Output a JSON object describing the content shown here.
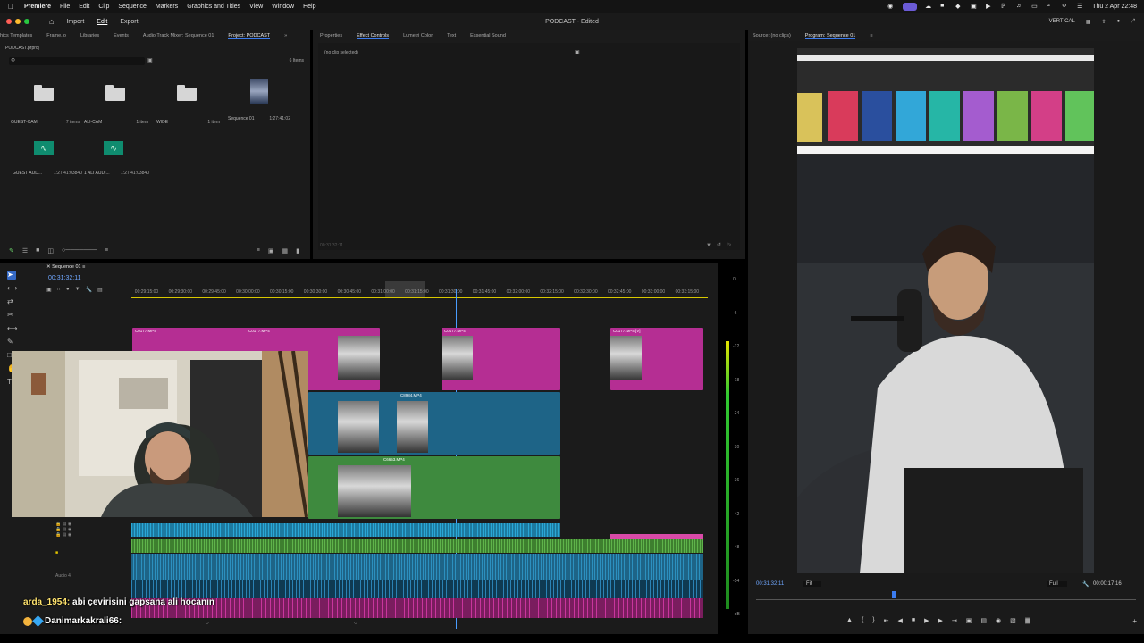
{
  "menubar": {
    "app": "Premiere",
    "items": [
      "File",
      "Edit",
      "Clip",
      "Sequence",
      "Markers",
      "Graphics and Titles",
      "View",
      "Window",
      "Help"
    ],
    "vertical_label": "VERTICAL",
    "datetime": "Thu 2 Apr  22:48"
  },
  "header": {
    "tabs": [
      "Import",
      "Edit",
      "Export"
    ],
    "active_tab": "Edit",
    "doc_title": "PODCAST - Edited"
  },
  "project": {
    "tabs": [
      "hics Templates",
      "Frame.io",
      "Libraries",
      "Events",
      "Audio Track Mixer: Sequence 01",
      "Project: PODCAST"
    ],
    "active_tab": "Project: PODCAST",
    "filename": "PODCAST.prproj",
    "item_count": "6 Items",
    "assets": [
      {
        "name": "GUEST-CAM",
        "count": "7 items",
        "kind": "folder"
      },
      {
        "name": "ALI-CAM",
        "count": "1 item",
        "kind": "folder"
      },
      {
        "name": "WIDE",
        "count": "1 item",
        "kind": "folder"
      },
      {
        "name": "Sequence 01",
        "count": "1:27:41:02",
        "kind": "sequence"
      },
      {
        "name": "GUEST AUD...",
        "count": "1:27:41:03840",
        "kind": "audio"
      },
      {
        "name": "1 ALI AUDI...",
        "count": "1:27:41:03840",
        "kind": "audio"
      }
    ]
  },
  "effects": {
    "tabs": [
      "Properties",
      "Effect Controls",
      "Lumetri Color",
      "Text",
      "Essential Sound"
    ],
    "active_tab": "Effect Controls",
    "empty_label": "(no clip selected)",
    "footer_tc": "00:31:32:11"
  },
  "program": {
    "tabs": [
      "Source: (no clips)",
      "Program: Sequence 01"
    ],
    "active_tab": "Program: Sequence 01",
    "timecode": "00:31:32:11",
    "fit": "Fit",
    "quality": "Full",
    "duration": "00:00:17:16"
  },
  "timeline": {
    "sequence_tab": "Sequence 01",
    "timecode": "00:31:32:11",
    "ruler": [
      "00:29:15:00",
      "00:29:30:00",
      "00:29:45:00",
      "00:30:00:00",
      "00:30:15:00",
      "00:30:30:00",
      "00:30:45:00",
      "00:31:00:00",
      "00:31:15:00",
      "00:31:30:00",
      "00:31:45:00",
      "00:32:00:00",
      "00:32:15:00",
      "00:32:30:00",
      "00:32:45:00",
      "00:33:00:00",
      "00:33:15:00"
    ],
    "clips": {
      "v3a": "C0177.MP4",
      "v3b": "C0177.MP4",
      "v3c": "C0177.MP4",
      "v3d": "C0177.MP4 [V]",
      "v2": "C8984.MP4",
      "v1": "C6653.MP4"
    },
    "audio_label": "Audio 4",
    "meter_scale": [
      "0",
      "-6",
      "-12",
      "-18",
      "-24",
      "-30",
      "-36",
      "-42",
      "-48",
      "-54",
      "-dB"
    ]
  },
  "chat": [
    {
      "user": "arda_1954:",
      "text": "abi çevirisini gapsana ali hocanın"
    },
    {
      "user": "",
      "text": "Danimarkakrali66:"
    }
  ]
}
